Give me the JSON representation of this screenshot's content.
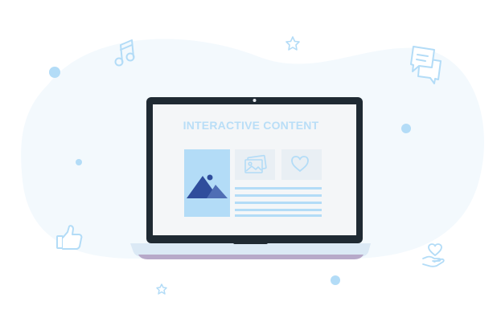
{
  "screen": {
    "title": "INTERACTIVE CONTENT"
  },
  "icons": [
    "music-note-icon",
    "star-icon",
    "chat-bubbles-icon",
    "thumbs-up-icon",
    "heart-hand-icon",
    "image-icon",
    "heart-icon",
    "mountain-image-icon"
  ],
  "colors": {
    "blob": "#f3f9fd",
    "accent_light": "#b3dcf7",
    "accent_dark": "#2f4d9c",
    "laptop_frame": "#1f2a33",
    "screen_bg": "#f4f6f8",
    "title": "#b9def7",
    "base": "#dbe9f5",
    "base_shadow": "#b7a9c9"
  }
}
